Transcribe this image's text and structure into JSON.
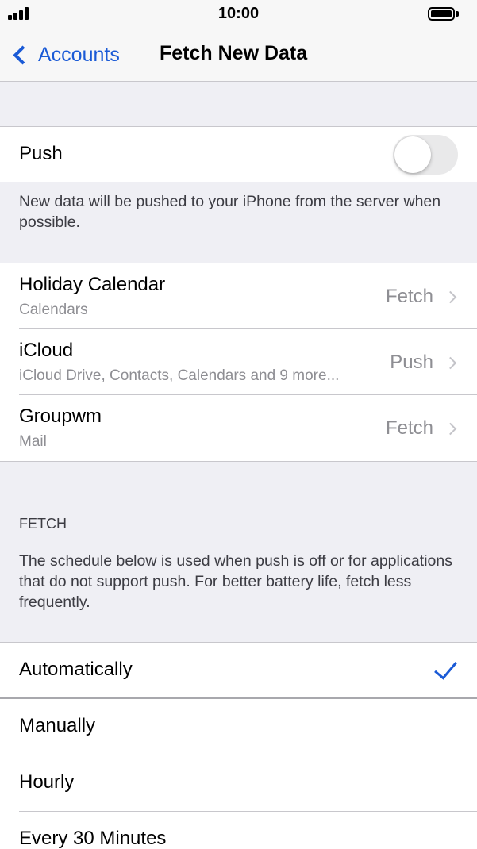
{
  "status_bar": {
    "time": "10:00"
  },
  "nav": {
    "back_label": "Accounts",
    "title": "Fetch New Data"
  },
  "push": {
    "label": "Push",
    "enabled": false,
    "footnote": "New data will be pushed to your iPhone from the server when possible."
  },
  "accounts": [
    {
      "title": "Holiday Calendar",
      "subtitle": "Calendars",
      "value": "Fetch"
    },
    {
      "title": "iCloud",
      "subtitle": "iCloud Drive, Contacts, Calendars and 9 more...",
      "value": "Push"
    },
    {
      "title": "Groupwm",
      "subtitle": "Mail",
      "value": "Fetch"
    }
  ],
  "fetch": {
    "header": "FETCH",
    "footnote": "The schedule below is used when push is off or for applications that do not support push. For better battery life, fetch less frequently.",
    "options": [
      {
        "label": "Automatically",
        "selected": true
      },
      {
        "label": "Manually",
        "selected": false
      },
      {
        "label": "Hourly",
        "selected": false
      },
      {
        "label": "Every 30 Minutes",
        "selected": false
      }
    ]
  },
  "colors": {
    "accent": "#1a5ad6",
    "background": "#efeff4",
    "secondary_text": "#8e8e93"
  }
}
